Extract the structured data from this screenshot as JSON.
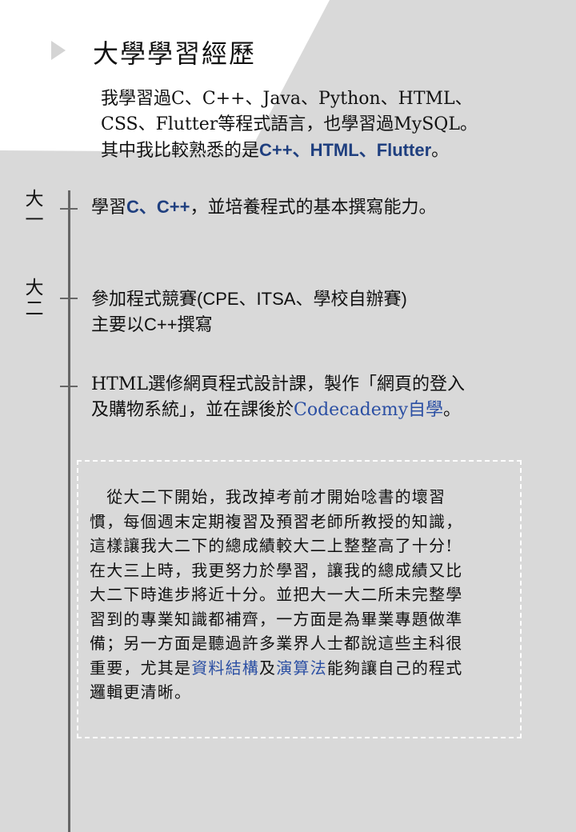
{
  "title": "大學學習經歷",
  "intro": {
    "line1": "我學習過C、C++、Java、Python、HTML、",
    "line2": "CSS、Flutter等程式語言，也學習過MySQL。",
    "line3_pre": "其中我比較熟悉的是",
    "line3_hl": "C++、HTML、Flutter",
    "line3_post": "。"
  },
  "timeline": {
    "year1": {
      "char1": "大",
      "char2": "一"
    },
    "year2": {
      "char1": "大",
      "char2": "二"
    },
    "item1": {
      "pre": "學習",
      "hl": "C、C++",
      "post": "，並培養程式的基本撰寫能力。"
    },
    "item2": {
      "line1": "參加程式競賽(CPE、ITSA、學校自辦賽)",
      "line2": "主要以C++撰寫"
    },
    "item3": {
      "line1": "HTML選修網頁程式設計課，製作「網頁的登入",
      "line2_pre": "及購物系統」，並在課後於",
      "line2_link": "Codecademy自學",
      "line2_post": "。"
    }
  },
  "note": {
    "line1": "　從大二下開始，我改掉考前才開始唸書的壞習",
    "line2": "慣，每個週末定期複習及預習老師所教授的知識，",
    "line3": "這樣讓我大二下的總成績較大二上整整高了十分!",
    "line4": "在大三上時，我更努力於學習，讓我的總成績又比",
    "line5": "大二下時進步將近十分。並把大一大二所未完整學",
    "line6": "習到的專業知識都補齊，一方面是為畢業專題做準",
    "line7": "備；另一方面是聽過許多業界人士都說這些主科很",
    "line8_pre": "重要，尤其是",
    "line8_link1": "資料結構",
    "line8_mid": "及",
    "line8_link2": "演算法",
    "line8_post": "能夠讓自己的程式",
    "line9": "邏輯更清晰。"
  },
  "colors": {
    "background": "#d9d9d9",
    "panel": "#ffffff",
    "highlight": "#1f3f7f",
    "link": "#2b4fa3",
    "timeline": "#666666"
  }
}
